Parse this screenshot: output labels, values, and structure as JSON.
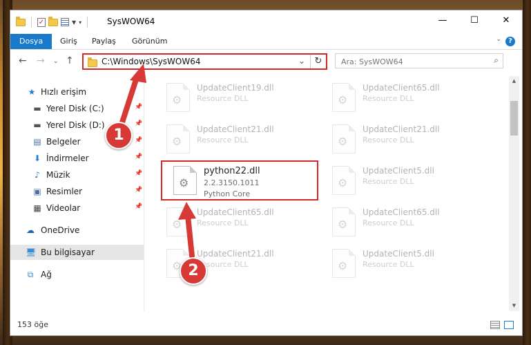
{
  "window": {
    "title": "SysWOW64",
    "controls": {
      "minimize": "—",
      "maximize": "☐",
      "close": "✕"
    }
  },
  "ribbon": {
    "tabs": [
      {
        "label": "Dosya",
        "active": true
      },
      {
        "label": "Giriş"
      },
      {
        "label": "Paylaş"
      },
      {
        "label": "Görünüm"
      }
    ],
    "help": "?"
  },
  "nav": {
    "address": "C:\\Windows\\SysWOW64",
    "search_placeholder": "Ara: SysWOW64"
  },
  "sidebar": {
    "items": [
      {
        "label": "Hızlı erişim",
        "icon": "star-icon",
        "pinned": false
      },
      {
        "label": "Yerel Disk (C:)",
        "icon": "drive-icon",
        "pinned": true
      },
      {
        "label": "Yerel Disk (D:)",
        "icon": "drive-icon",
        "pinned": true
      },
      {
        "label": "Belgeler",
        "icon": "documents-icon",
        "pinned": true
      },
      {
        "label": "İndirmeler",
        "icon": "download-icon",
        "pinned": true
      },
      {
        "label": "Müzik",
        "icon": "music-icon",
        "pinned": true
      },
      {
        "label": "Resimler",
        "icon": "pictures-icon",
        "pinned": true
      },
      {
        "label": "Videolar",
        "icon": "video-icon",
        "pinned": true
      },
      {
        "label": "OneDrive",
        "icon": "cloud-icon",
        "pinned": false
      },
      {
        "label": "Bu bilgisayar",
        "icon": "computer-icon",
        "pinned": false,
        "selected": true
      },
      {
        "label": "Ağ",
        "icon": "network-icon",
        "pinned": false
      }
    ]
  },
  "files": {
    "tiles": [
      {
        "name": "UpdateClient19.dll",
        "line2": "Resource DLL",
        "faded": true
      },
      {
        "name": "UpdateClient65.dll",
        "line2": "Resource DLL",
        "faded": true
      },
      {
        "name": "UpdateClient21.dll",
        "line2": "Resource DLL",
        "faded": true
      },
      {
        "name": "UpdateClient21.dll",
        "line2": "Resource DLL",
        "faded": true
      },
      {
        "name": "python22.dll",
        "line2": "2.2.3150.1011",
        "line3": "Python Core",
        "faded": false,
        "highlighted": true
      },
      {
        "name": "UpdateClient5.dll",
        "line2": "Resource DLL",
        "faded": true
      },
      {
        "name": "UpdateClient65.dll",
        "line2": "Resource DLL",
        "faded": true
      },
      {
        "name": "UpdateClient65.dll",
        "line2": "Resource DLL",
        "faded": true
      },
      {
        "name": "UpdateClient21.dll",
        "line2": "Resource DLL",
        "faded": true
      },
      {
        "name": "UpdateClient5.dll",
        "line2": "Resource DLL",
        "faded": true
      }
    ]
  },
  "status": {
    "count": "153 öğe"
  },
  "annotations": {
    "badge1": "1",
    "badge2": "2"
  },
  "colors": {
    "accent": "#1979ca",
    "highlight": "#d22a2a",
    "badge": "#d73a36"
  }
}
